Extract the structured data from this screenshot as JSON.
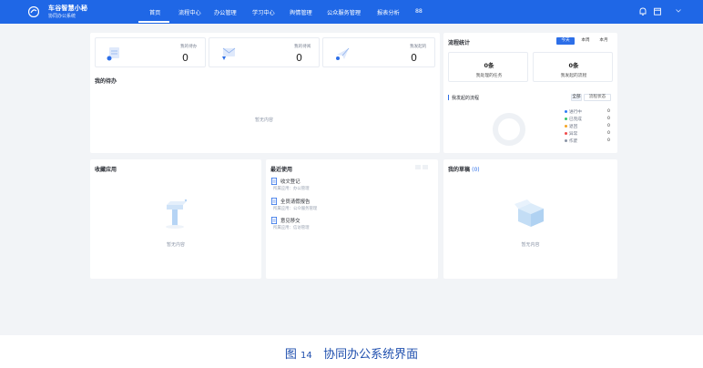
{
  "brand": {
    "title": "车谷智慧小秘",
    "subtitle": "协同办公系统"
  },
  "nav": {
    "items": [
      "首页",
      "流程中心",
      "办公管理",
      "学习中心",
      "舆情管理",
      "公众服务管理",
      "报表分析",
      "88"
    ],
    "active": 0
  },
  "topbar": {
    "icons": [
      "bell-icon",
      "calendar-icon",
      "user-icon"
    ]
  },
  "stats": [
    {
      "label": "我的待办",
      "value": "0",
      "icon": "document-icon"
    },
    {
      "label": "我的待阅",
      "value": "0",
      "icon": "mail-icon"
    },
    {
      "label": "我发起的",
      "value": "0",
      "icon": "send-icon"
    }
  ],
  "my_todo": {
    "title": "我的待办",
    "empty_text": "暂无内容"
  },
  "process_stats": {
    "title": "流程统计",
    "tabs": [
      "今天",
      "本周",
      "本月"
    ],
    "active_tab": 0,
    "boxes": [
      {
        "value": "0条",
        "label": "我处理的任务"
      },
      {
        "value": "0条",
        "label": "我发起的流程"
      }
    ],
    "sub_title": "我发起的流程",
    "sub_tabs": [
      "全部",
      "流程状态"
    ],
    "legend": [
      {
        "label": "进行中",
        "value": "0",
        "color": "#2d7cf6"
      },
      {
        "label": "已完成",
        "value": "0",
        "color": "#36c46b"
      },
      {
        "label": "退回",
        "value": "0",
        "color": "#f5a524"
      },
      {
        "label": "异常",
        "value": "0",
        "color": "#f04b4b"
      },
      {
        "label": "作废",
        "value": "0",
        "color": "#8a94a6"
      }
    ]
  },
  "favorite_apps": {
    "title": "收藏应用",
    "empty_text": "暂无内容"
  },
  "recent_apps": {
    "title": "最近使用",
    "items": [
      {
        "title": "收文登记",
        "sub": "所属应用：办公管理"
      },
      {
        "title": "全员请假报告",
        "sub": "所属应用：公众服务管理"
      },
      {
        "title": "意见移交",
        "sub": "所属应用：信访管理"
      }
    ]
  },
  "my_drafts": {
    "title": "我的草稿",
    "count": "(0)",
    "empty_text": "暂无内容"
  },
  "caption": {
    "prefix": "图",
    "number": "14",
    "text": "协同办公系统界面"
  }
}
